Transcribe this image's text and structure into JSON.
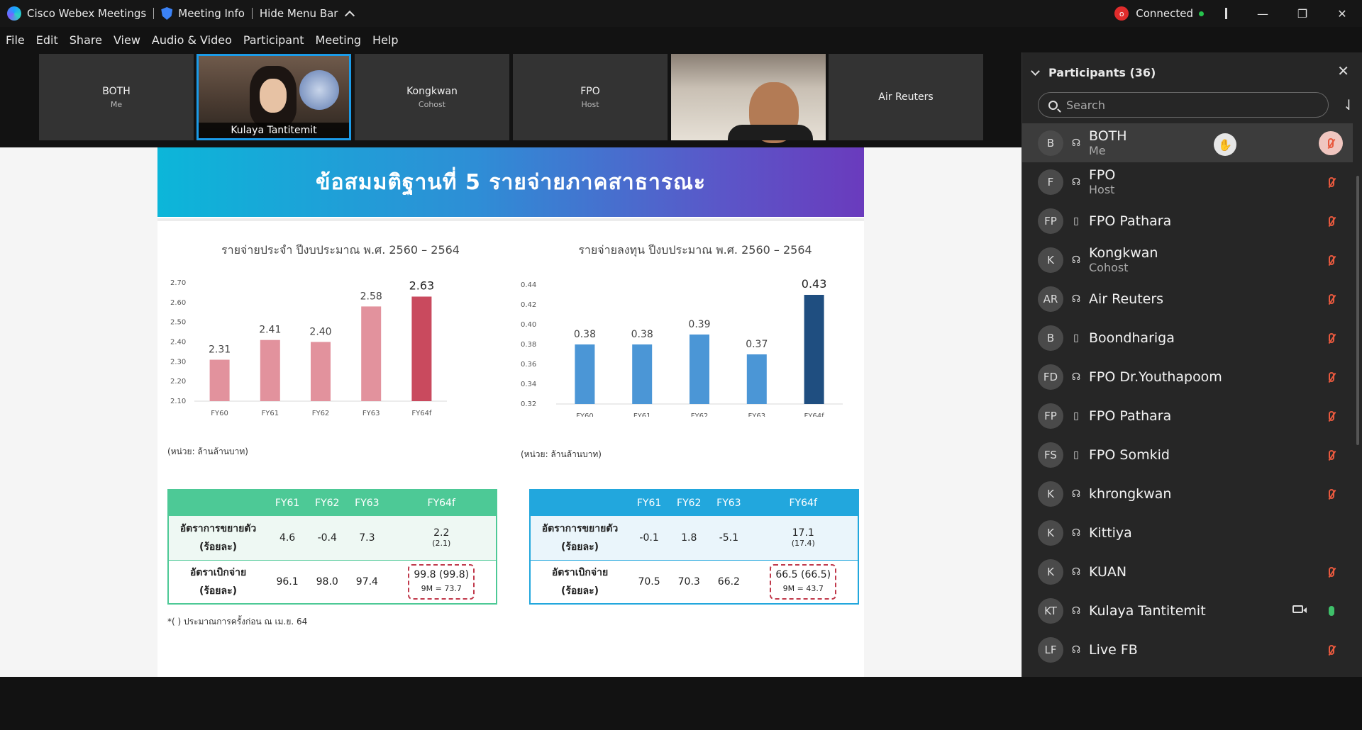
{
  "titlebar": {
    "app_name": "Cisco Webex Meetings",
    "meeting_info": "Meeting Info",
    "hide_menu": "Hide Menu Bar",
    "connection_status": "Connected",
    "rec_badge": "o",
    "minimize": "—",
    "restore": "❐",
    "close": "✕"
  },
  "menubar": [
    "File",
    "Edit",
    "Share",
    "View",
    "Audio & Video",
    "Participant",
    "Meeting",
    "Help"
  ],
  "video_strip": [
    {
      "name": "BOTH",
      "role": "Me"
    },
    {
      "name": "Kulaya Tantitemit",
      "role": ""
    },
    {
      "name": "Kongkwan",
      "role": "Cohost"
    },
    {
      "name": "FPO",
      "role": "Host"
    },
    {
      "name": "",
      "role": ""
    },
    {
      "name": "Air Reuters",
      "role": ""
    }
  ],
  "slide": {
    "title": "ข้อสมมติฐานที่ 5  รายจ่ายภาคสาธารณะ",
    "unit_left": "(หน่วย: ล้านล้านบาท)",
    "unit_right": "(หน่วย: ล้านล้านบาท)",
    "footnote": "*( ) ประมาณการครั้งก่อน ณ เม.ย. 64"
  },
  "chart_data": [
    {
      "type": "bar",
      "title": "รายจ่ายประจำ ปีงบประมาณ พ.ศ. 2560 – 2564",
      "categories": [
        "FY60",
        "FY61",
        "FY62",
        "FY63",
        "FY64f"
      ],
      "values": [
        2.31,
        2.41,
        2.4,
        2.58,
        2.63
      ],
      "yticks": [
        "2.70",
        "2.60",
        "2.50",
        "2.40",
        "2.30",
        "2.20",
        "2.10"
      ],
      "ylim": [
        2.1,
        2.7
      ],
      "colors": [
        "#e2929d",
        "#e2929d",
        "#e2929d",
        "#e2929d",
        "#c94a5e"
      ],
      "grid": false
    },
    {
      "type": "bar",
      "title": "รายจ่ายลงทุน ปีงบประมาณ พ.ศ. 2560 – 2564",
      "categories": [
        "FY60",
        "FY61",
        "FY62",
        "FY63",
        "FY64f"
      ],
      "values": [
        0.38,
        0.38,
        0.39,
        0.37,
        0.43
      ],
      "yticks": [
        "0.44",
        "0.42",
        "0.40",
        "0.38",
        "0.36",
        "0.34",
        "0.32"
      ],
      "ylim": [
        0.32,
        0.44
      ],
      "colors": [
        "#4b96d6",
        "#4b96d6",
        "#4b96d6",
        "#4b96d6",
        "#1f4e80"
      ],
      "grid": false
    }
  ],
  "table_left": {
    "header_color": "#4dc996",
    "body_color": "#eef8f3",
    "columns": [
      "FY61",
      "FY62",
      "FY63",
      "FY64f"
    ],
    "rows": [
      {
        "label": "อัตราการขยายตัว",
        "sub": "(ร้อยละ)",
        "values": [
          "4.6",
          "-0.4",
          "7.3"
        ],
        "last_main": "2.2",
        "last_extra": "(2.1)"
      },
      {
        "label": "อัตราเบิกจ่าย",
        "sub": "(ร้อยละ)",
        "values": [
          "96.1",
          "98.0",
          "97.4"
        ],
        "last_main": "99.8 (99.8)",
        "last_extra": "9M = 73.7"
      }
    ]
  },
  "table_right": {
    "header_color": "#22a7dd",
    "body_color": "#eaf5fb",
    "columns": [
      "FY61",
      "FY62",
      "FY63",
      "FY64f"
    ],
    "rows": [
      {
        "label": "อัตราการขยายตัว",
        "sub": "(ร้อยละ)",
        "values": [
          "-0.1",
          "1.8",
          "-5.1"
        ],
        "last_main": "17.1",
        "last_extra": "(17.4)"
      },
      {
        "label": "อัตราเบิกจ่าย",
        "sub": "(ร้อยละ)",
        "values": [
          "70.5",
          "70.3",
          "66.2"
        ],
        "last_main": "66.5 (66.5)",
        "last_extra": "9M = 43.7"
      }
    ]
  },
  "participants": {
    "title": "Participants (36)",
    "search_placeholder": "Search",
    "list": [
      {
        "initials": "B",
        "name": "BOTH",
        "role": "Me",
        "device": "headset",
        "mic": "muted-highlight"
      },
      {
        "initials": "F",
        "name": "FPO",
        "role": "Host",
        "device": "headset",
        "mic": "muted"
      },
      {
        "initials": "FP",
        "name": "FPO Pathara",
        "role": "",
        "device": "phone",
        "mic": "muted"
      },
      {
        "initials": "K",
        "name": "Kongkwan",
        "role": "Cohost",
        "device": "headset",
        "mic": "muted"
      },
      {
        "initials": "AR",
        "name": "Air Reuters",
        "role": "",
        "device": "headset",
        "mic": "muted"
      },
      {
        "initials": "B",
        "name": "Boondhariga",
        "role": "",
        "device": "phone",
        "mic": "muted"
      },
      {
        "initials": "FD",
        "name": "FPO Dr.Youthapoom",
        "role": "",
        "device": "headset",
        "mic": "muted"
      },
      {
        "initials": "FP",
        "name": "FPO Pathara",
        "role": "",
        "device": "phone",
        "mic": "muted"
      },
      {
        "initials": "FS",
        "name": "FPO Somkid",
        "role": "",
        "device": "phone",
        "mic": "muted"
      },
      {
        "initials": "K",
        "name": "khrongkwan",
        "role": "",
        "device": "headset",
        "mic": "muted"
      },
      {
        "initials": "K",
        "name": "Kittiya",
        "role": "",
        "device": "headset",
        "mic": "none"
      },
      {
        "initials": "K",
        "name": "KUAN",
        "role": "",
        "device": "headset",
        "mic": "muted"
      },
      {
        "initials": "KT",
        "name": "Kulaya Tantitemit",
        "role": "",
        "device": "headset",
        "mic": "on",
        "camera": true
      },
      {
        "initials": "LF",
        "name": "Live FB",
        "role": "",
        "device": "headset",
        "mic": "muted"
      }
    ]
  }
}
